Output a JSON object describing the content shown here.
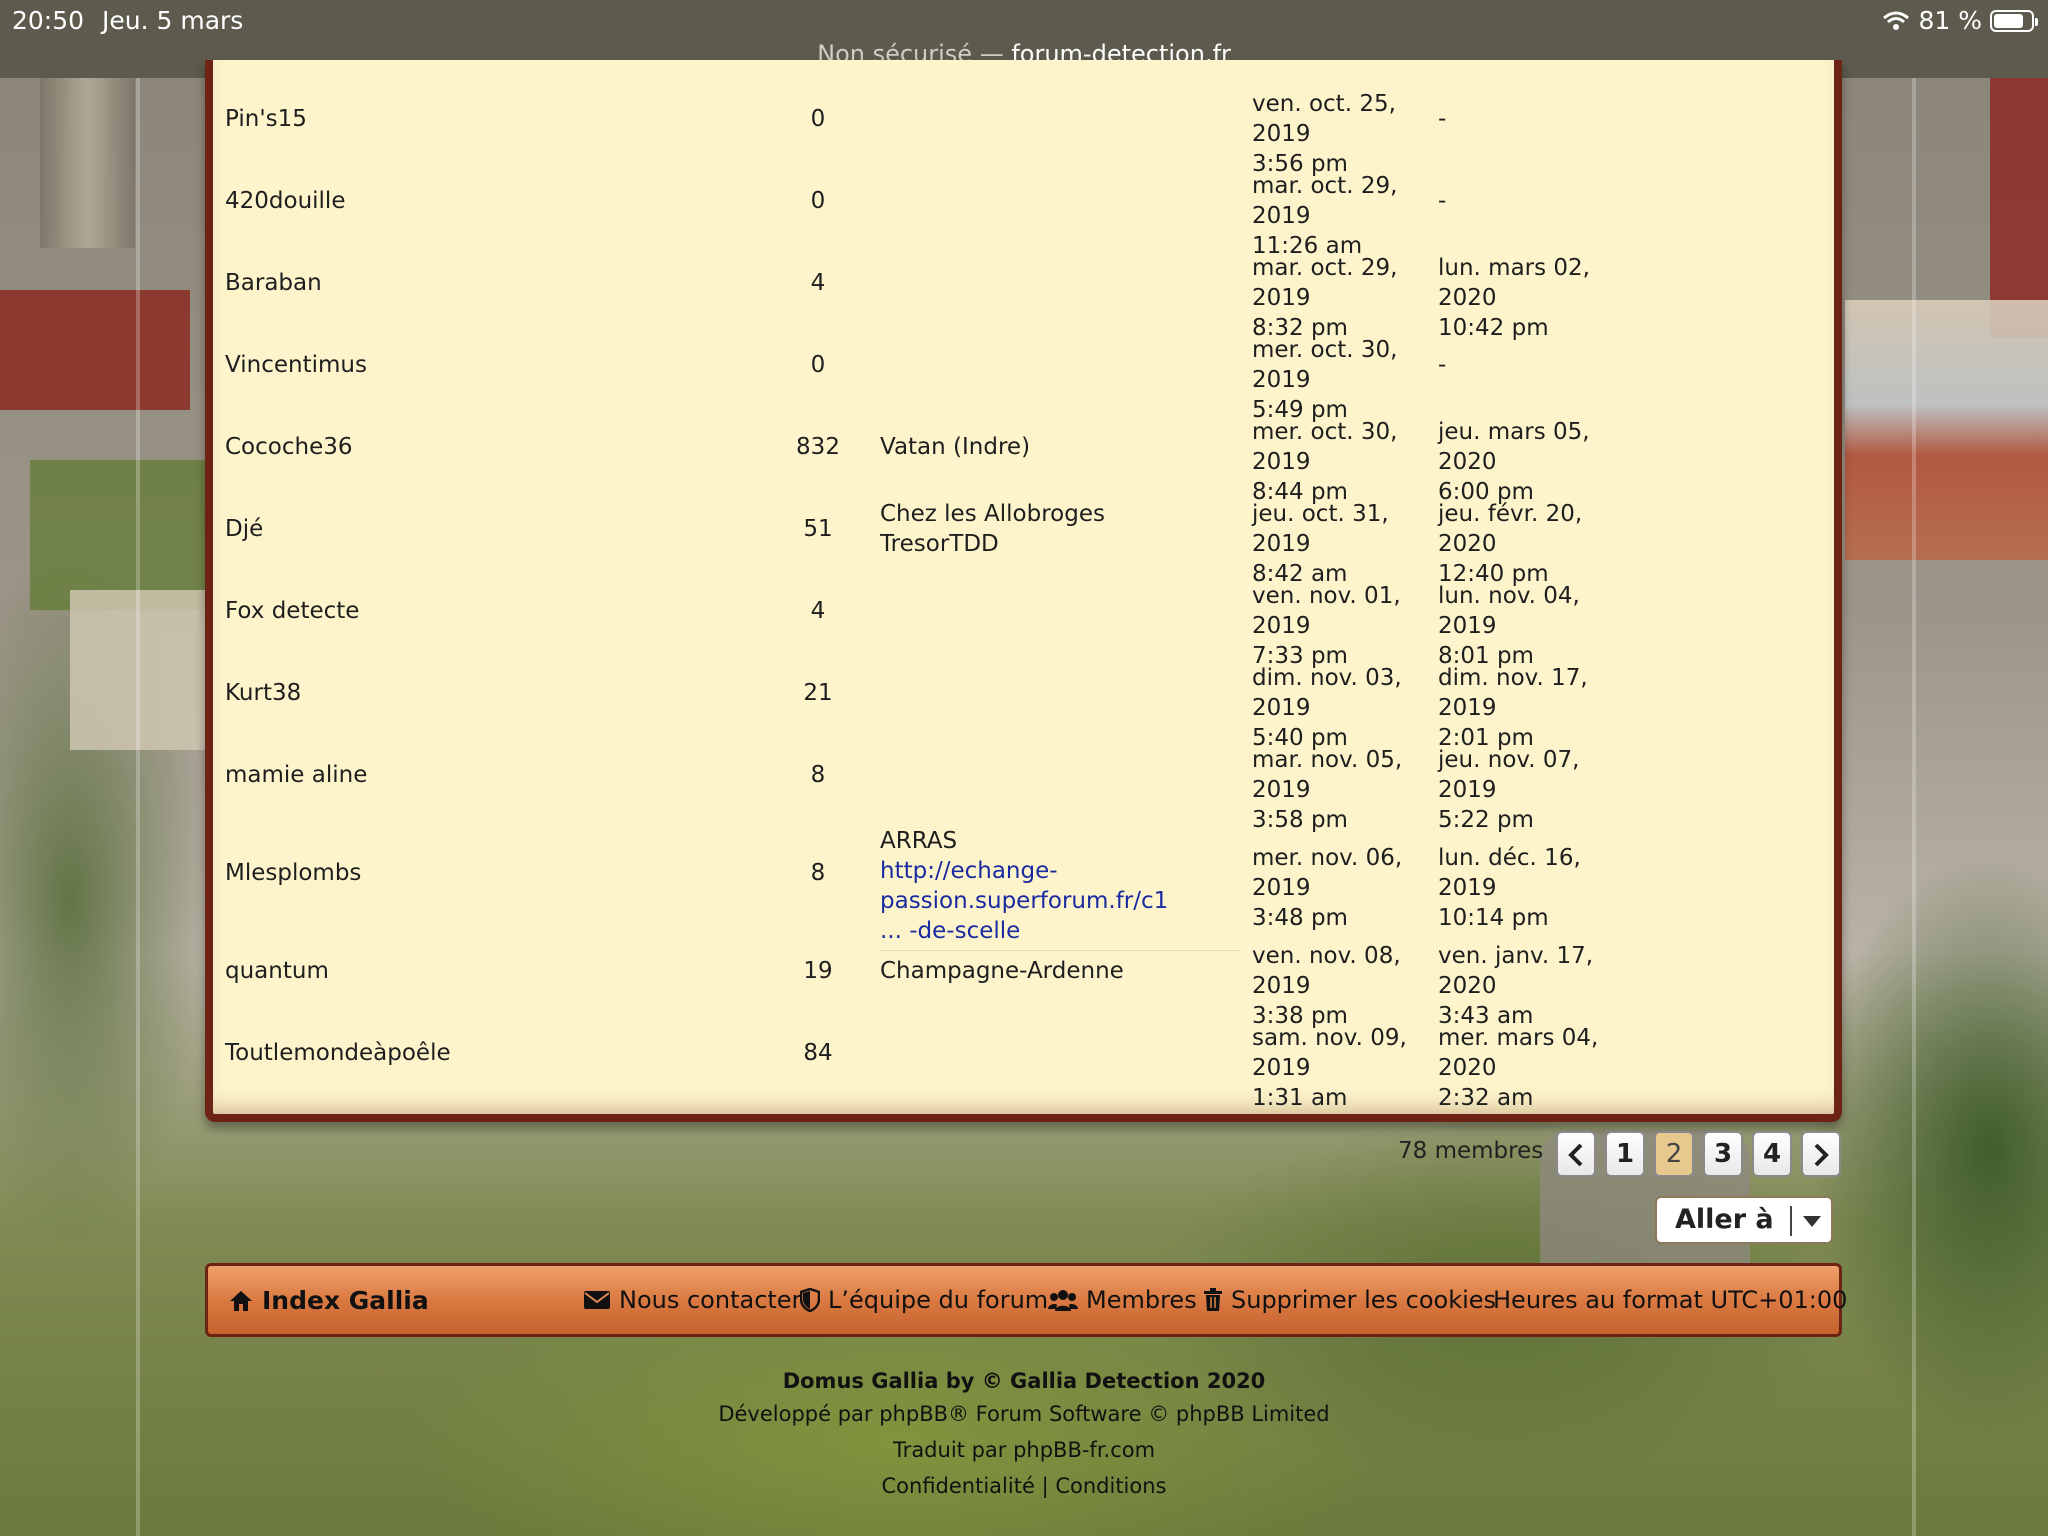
{
  "status_bar": {
    "time": "20:50",
    "date": "Jeu. 5 mars",
    "battery": "81 %",
    "battery_level": 0.81,
    "url_prefix": "Non sécurisé —",
    "url_host": "forum-detection.fr"
  },
  "members_table": {
    "rows": [
      {
        "name": "Pin's15",
        "posts": "0",
        "location": "",
        "registered": [
          "ven. oct. 25, 2019",
          "3:56 pm"
        ],
        "last_visit": [
          "-"
        ]
      },
      {
        "name": "420douille",
        "posts": "0",
        "location": "",
        "registered": [
          "mar. oct. 29, 2019",
          "11:26 am"
        ],
        "last_visit": [
          "-"
        ]
      },
      {
        "name": "Baraban",
        "posts": "4",
        "location": "",
        "registered": [
          "mar. oct. 29, 2019",
          "8:32 pm"
        ],
        "last_visit": [
          "lun. mars 02, 2020",
          "10:42 pm"
        ]
      },
      {
        "name": "Vincentimus",
        "posts": "0",
        "location": "",
        "registered": [
          "mer. oct. 30, 2019",
          "5:49 pm"
        ],
        "last_visit": [
          "-"
        ]
      },
      {
        "name": "Cocoche36",
        "posts": "832",
        "location": "Vatan (Indre)",
        "registered": [
          "mer. oct. 30, 2019",
          "8:44 pm"
        ],
        "last_visit": [
          "jeu. mars 05, 2020",
          "6:00 pm"
        ]
      },
      {
        "name": "Djé",
        "posts": "51",
        "location": "Chez les Allobroges",
        "location2": "TresorTDD",
        "registered": [
          "jeu. oct. 31, 2019",
          "8:42 am"
        ],
        "last_visit": [
          "jeu. févr. 20, 2020",
          "12:40 pm"
        ]
      },
      {
        "name": "Fox detecte",
        "posts": "4",
        "location": "",
        "registered": [
          "ven. nov. 01, 2019",
          "7:33 pm"
        ],
        "last_visit": [
          "lun. nov. 04, 2019",
          "8:01 pm"
        ]
      },
      {
        "name": "Kurt38",
        "posts": "21",
        "location": "",
        "registered": [
          "dim. nov. 03, 2019",
          "5:40 pm"
        ],
        "last_visit": [
          "dim. nov. 17, 2019",
          "2:01 pm"
        ]
      },
      {
        "name": "mamie aline",
        "posts": "8",
        "location": "",
        "registered": [
          "mar. nov. 05, 2019",
          "3:58 pm"
        ],
        "last_visit": [
          "jeu. nov. 07, 2019",
          "5:22 pm"
        ]
      },
      {
        "name": "Mlesplombs",
        "posts": "8",
        "location": "ARRAS",
        "location_link_1": "http://echange-passion.superforum.fr/c1",
        "location_link_2": "... -de-scelle",
        "registered": [
          "mer. nov. 06, 2019",
          "3:48 pm"
        ],
        "last_visit": [
          "lun. déc. 16, 2019",
          "10:14 pm"
        ]
      },
      {
        "name": "quantum",
        "posts": "19",
        "location": "Champagne-Ardenne",
        "registered": [
          "ven. nov. 08, 2019",
          "3:38 pm"
        ],
        "last_visit": [
          "ven. janv. 17, 2020",
          "3:43 am"
        ]
      },
      {
        "name": "Toutlemondeàpoêle",
        "posts": "84",
        "location": "",
        "registered": [
          "sam. nov. 09, 2019",
          "1:31 am"
        ],
        "last_visit": [
          "mer. mars 04, 2020",
          "2:32 am"
        ]
      }
    ]
  },
  "pagination": {
    "count_label": "78 membres",
    "pages": [
      "1",
      "2",
      "3",
      "4"
    ],
    "current": "2",
    "prev_icon": "chevron-left-icon",
    "next_icon": "chevron-right-icon"
  },
  "jump": {
    "label": "Aller à"
  },
  "navbar": {
    "home": "Index Gallia",
    "contact": "Nous contacter",
    "team": "L’équipe du forum",
    "members": "Membres",
    "cookies": "Supprimer les cookies",
    "timezone": "Heures au format UTC+01:00"
  },
  "footer": {
    "line1": "Domus Gallia by © Gallia Detection 2020",
    "line2": "Développé par phpBB® Forum Software © phpBB Limited",
    "line3": "Traduit par phpBB-fr.com",
    "privacy": "Confidentialité",
    "separator": "|",
    "terms": "Conditions"
  },
  "colors": {
    "panel_bg": "#fdf4cc",
    "panel_border": "#6e2414",
    "navbar": "#d8773f",
    "link": "#1a2aa0",
    "active_page": "#e7c98e"
  }
}
